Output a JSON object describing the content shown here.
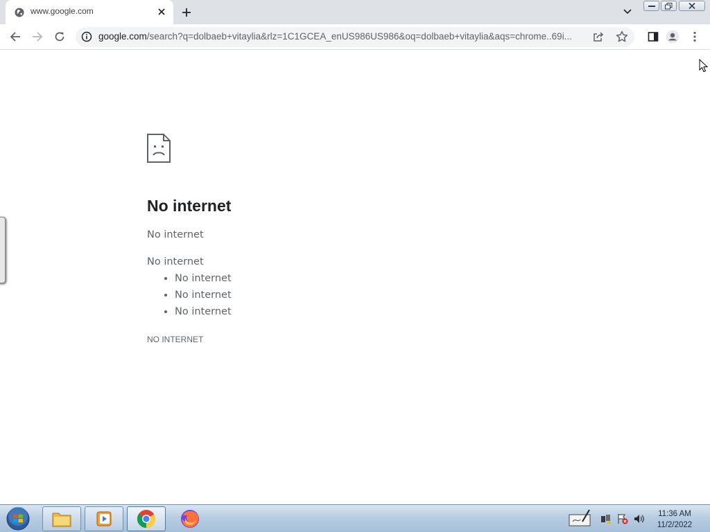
{
  "browser": {
    "tab": {
      "title": "www.google.com",
      "favicon": "globe-icon"
    },
    "url_host": "google.com",
    "url_rest": "/search?q=dolbaeb+vitaylia&rlz=1C1GCEA_enUS986US986&oq=dolbaeb+vitaylia&aqs=chrome..69i...",
    "icons": [
      "back-icon",
      "forward-icon",
      "reload-icon",
      "info-icon",
      "share-icon",
      "star-icon",
      "side-panel-icon",
      "profile-icon",
      "menu-icon"
    ]
  },
  "page": {
    "title": "No internet",
    "subtitle": "No internet",
    "try_label": "No internet",
    "suggestions": [
      "No internet",
      "No internet",
      "No internet"
    ],
    "error_code": "NO INTERNET"
  },
  "taskbar": {
    "apps": [
      "windows-explorer-icon",
      "media-player-icon",
      "chrome-icon",
      "firefox-icon"
    ],
    "time": "11:36 AM",
    "date": "11/2/2022"
  },
  "colors": {
    "tabstrip": "#dee1e6",
    "omnibox": "#f1f3f4",
    "text_secondary": "#5f6368"
  }
}
